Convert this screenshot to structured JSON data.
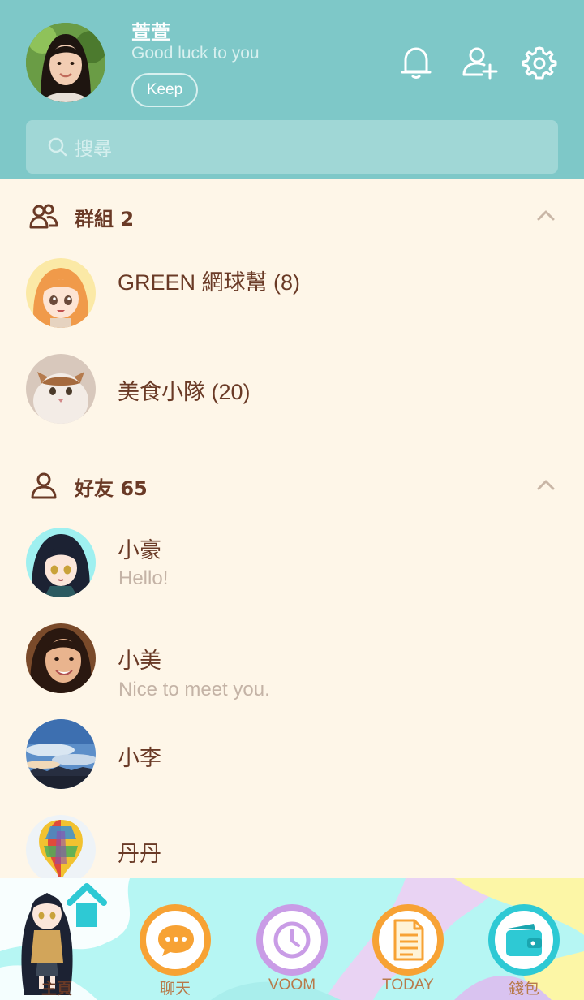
{
  "profile": {
    "name": "萱萱",
    "status": "Good luck to you",
    "keep_label": "Keep"
  },
  "header_icons": [
    "bell-icon",
    "add-friend-icon",
    "gear-icon"
  ],
  "search": {
    "placeholder": "搜尋"
  },
  "groups": {
    "label": "群組 2",
    "items": [
      {
        "name": "GREEN 網球幫 (8)",
        "avatar": "anime-girl-orange-hair"
      },
      {
        "name": "美食小隊 (20)",
        "avatar": "cat"
      }
    ]
  },
  "friends": {
    "label": "好友 65",
    "items": [
      {
        "name": "小豪",
        "message": "Hello!",
        "avatar": "anime-girl-dark-hair"
      },
      {
        "name": "小美",
        "message": "Nice to meet you.",
        "avatar": "woman-photo"
      },
      {
        "name": "小李",
        "message": "",
        "avatar": "sky-clouds"
      },
      {
        "name": "丹丹",
        "message": "",
        "avatar": "hot-air-balloon"
      }
    ]
  },
  "nav": {
    "items": [
      {
        "label": "主頁",
        "icon": "home-icon",
        "color": "#2ec9d4"
      },
      {
        "label": "聊天",
        "icon": "chat-icon",
        "color": "#f7a234"
      },
      {
        "label": "VOOM",
        "icon": "clock-icon",
        "color": "#c99ce6"
      },
      {
        "label": "TODAY",
        "icon": "news-icon",
        "color": "#f7a234"
      },
      {
        "label": "錢包",
        "icon": "wallet-icon",
        "color": "#2ec9d4"
      }
    ]
  },
  "colors": {
    "header_bg": "#7ec8c8",
    "body_bg": "#fef6e8",
    "text_primary": "#6a3a26",
    "text_secondary": "#c4b3a6"
  }
}
